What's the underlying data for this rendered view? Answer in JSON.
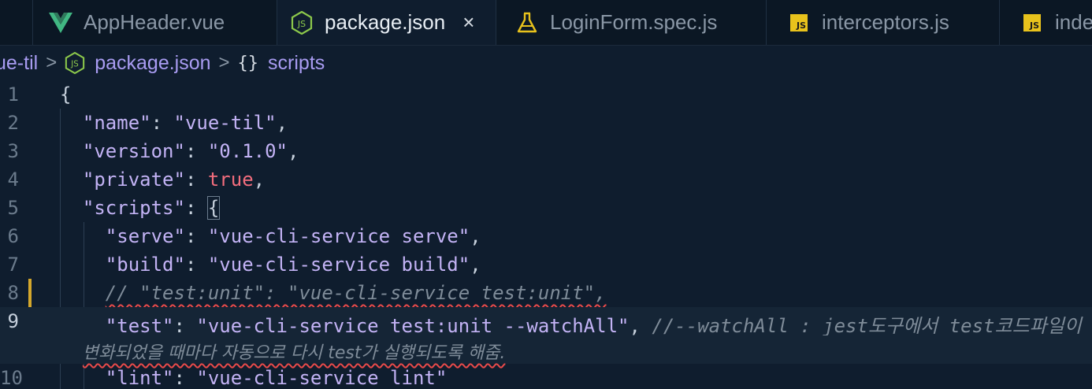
{
  "tabs": [
    {
      "label": "AppHeader.vue",
      "icon": "vue-icon",
      "active": false
    },
    {
      "label": "package.json",
      "icon": "nodejs-icon",
      "active": true,
      "close": "×"
    },
    {
      "label": "LoginForm.spec.js",
      "icon": "flask-icon",
      "active": false
    },
    {
      "label": "interceptors.js",
      "icon": "js-icon",
      "active": false
    },
    {
      "label": "inde",
      "icon": "js-icon",
      "active": false
    }
  ],
  "js_badge": "JS",
  "breadcrumb": {
    "project": "ue-til",
    "file": "package.json",
    "braces": "{}",
    "symbol": "scripts"
  },
  "code": {
    "line_numbers": [
      "1",
      "2",
      "3",
      "4",
      "5",
      "6",
      "7",
      "8",
      "9",
      "10"
    ],
    "l1_open": "{",
    "l2_key": "\"name\"",
    "l2_val": "\"vue-til\"",
    "l3_key": "\"version\"",
    "l3_val": "\"0.1.0\"",
    "l4_key": "\"private\"",
    "l4_val": "true",
    "l5_key": "\"scripts\"",
    "l5_brace": "{",
    "l6_key": "\"serve\"",
    "l6_val": "\"vue-cli-service serve\"",
    "l7_key": "\"build\"",
    "l7_val": "\"vue-cli-service build\"",
    "l8_comment": "// \"test:unit\": \"vue-cli-service test:unit\",",
    "l9_key": "\"test\"",
    "l9_val": "\"vue-cli-service test:unit --watchAll\"",
    "l9_comment": "//--watchAll : jest도구에서 test코드파일이",
    "l9_wrap": "변화되었을 때마다 자동으로 다시 test가 실행되도록 해줌.",
    "l10_key": "\"lint\"",
    "l10_val": "\"vue-cli-service lint\""
  },
  "colors": {
    "background": "#0f1d2e",
    "string": "#c3b3f5",
    "boolean": "#f26d7d",
    "comment": "#7f8c99",
    "modified": "#d4a72c",
    "squiggle": "#e84a4a"
  }
}
